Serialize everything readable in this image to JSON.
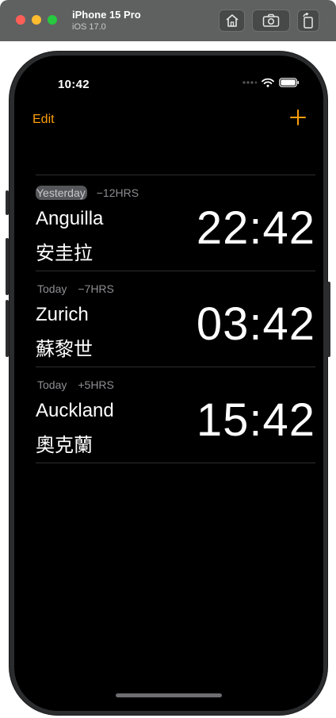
{
  "simulator": {
    "device_name": "iPhone 15 Pro",
    "os_version": "iOS 17.0"
  },
  "status_bar": {
    "time": "10:42"
  },
  "nav": {
    "edit_label": "Edit",
    "add_icon": "plus-icon",
    "accent_color": "#ff9f0a"
  },
  "world_clocks": [
    {
      "day": "Yesterday",
      "offset": "−12HRS",
      "city": "Anguilla",
      "city_local": "安圭拉",
      "time": "22:42",
      "day_highlighted": true
    },
    {
      "day": "Today",
      "offset": "−7HRS",
      "city": "Zurich",
      "city_local": "蘇黎世",
      "time": "03:42",
      "day_highlighted": false
    },
    {
      "day": "Today",
      "offset": "+5HRS",
      "city": "Auckland",
      "city_local": "奧克蘭",
      "time": "15:42",
      "day_highlighted": false
    }
  ]
}
